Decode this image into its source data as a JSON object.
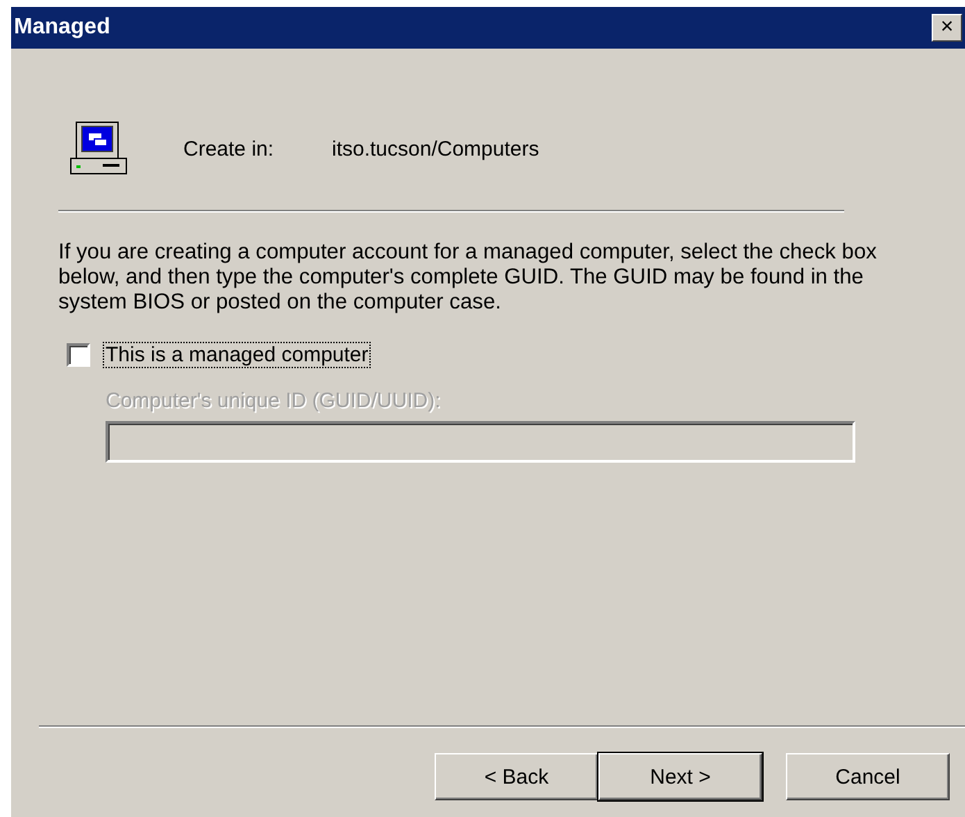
{
  "window": {
    "title": "Managed",
    "close": "×"
  },
  "create_in": {
    "label": "Create in:",
    "value": "itso.tucson/Computers"
  },
  "description": "If you are creating a computer account for a managed computer, select the check box below, and then type the computer's complete GUID. The GUID may be found in the system BIOS or posted on the computer case.",
  "managed_checkbox": {
    "label": "This is a managed computer",
    "checked": false,
    "focused": true
  },
  "guid_field": {
    "label": "Computer's unique ID (GUID/UUID):",
    "disabled": true
  },
  "buttons": [
    {
      "label": "< Back",
      "default": false
    },
    {
      "label": "Next >",
      "default": true
    },
    {
      "label": "Cancel",
      "default": false
    }
  ]
}
